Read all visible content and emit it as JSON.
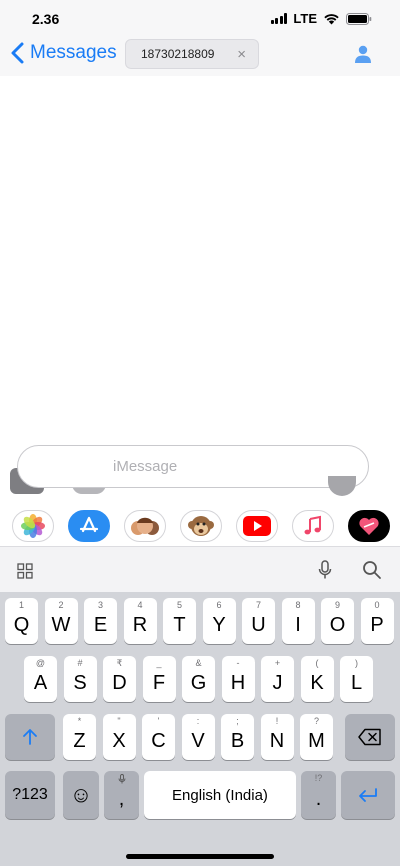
{
  "status_bar": {
    "time": "2.36",
    "network": "LTE"
  },
  "nav": {
    "back_label": "Messages",
    "recipient": "18730218809",
    "chip_close": "×"
  },
  "input": {
    "placeholder": "iMessage"
  },
  "apps": [
    "photos-app",
    "app-store",
    "memoji",
    "monkey-sticker",
    "youtube",
    "music",
    "digital-touch"
  ],
  "keyboard": {
    "row1": [
      [
        "1",
        "Q"
      ],
      [
        "2",
        "W"
      ],
      [
        "3",
        "E"
      ],
      [
        "4",
        "R"
      ],
      [
        "5",
        "T"
      ],
      [
        "6",
        "Y"
      ],
      [
        "7",
        "U"
      ],
      [
        "8",
        "I"
      ],
      [
        "9",
        "O"
      ],
      [
        "0",
        "P"
      ]
    ],
    "row2": [
      [
        "@",
        "A"
      ],
      [
        "#",
        "S"
      ],
      [
        "₹",
        "D"
      ],
      [
        "_",
        "F"
      ],
      [
        "&",
        "G"
      ],
      [
        "-",
        "H"
      ],
      [
        "+",
        "J"
      ],
      [
        "(",
        "K"
      ],
      [
        ")",
        "L"
      ]
    ],
    "row3": [
      [
        "*",
        "Z"
      ],
      [
        "\"",
        "X"
      ],
      [
        "'",
        "C"
      ],
      [
        ":",
        "V"
      ],
      [
        ";",
        "B"
      ],
      [
        "!",
        "N"
      ],
      [
        "?",
        "M"
      ]
    ],
    "numbers_label": "?123",
    "emoji_label": "☺",
    "comma_label": ",",
    "space_label": "English (India)",
    "period_label": ".",
    "period_hint": "!?"
  },
  "colors": {
    "accent": "#1a7cf5",
    "keyboard_bg": "#d2d4d9"
  }
}
